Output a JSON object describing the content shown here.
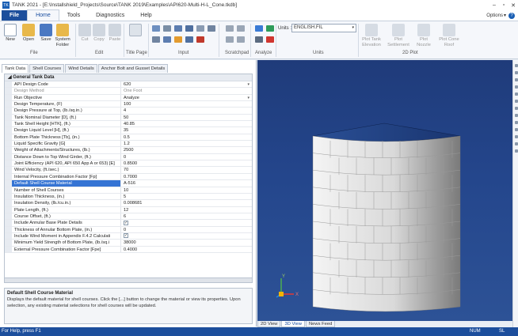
{
  "window": {
    "title": "TANK 2021 - [E:\\Installshield_Projects\\Source\\TANK 2019\\Examples\\API620-Multi-H-L_Cone.tkdb]",
    "app_icon": "TK"
  },
  "menu": {
    "file": "File",
    "tabs": [
      "Home",
      "Tools",
      "Diagnostics",
      "Help"
    ],
    "options": "Options",
    "help_badge": "?"
  },
  "ribbon": {
    "buttons": {
      "new": "New",
      "open": "Open",
      "save": "Save",
      "system_folder": "System\nFolder",
      "cut": "Cut",
      "copy": "Copy",
      "paste": "Paste",
      "plot_tank_elevation": "Plot Tank\nElevation",
      "plot_settlement": "Plot\nSettlement",
      "plot_nozzle": "Plot\nNozzle",
      "plot_cone_roof": "Plot Cone\nRoof"
    },
    "groups": {
      "file": "File",
      "edit": "Edit",
      "title_page": "Title Page",
      "input": "Input",
      "scratchpad": "Scratchpad",
      "analyze": "Analyze",
      "units": "Units",
      "plot_2d": "2D Plot"
    },
    "units_label": "Units :",
    "units_value": "ENGLISH.FIL"
  },
  "subtabs": [
    "Tank Data",
    "Shell Courses",
    "Wind Details",
    "Anchor Bolt and Gusset Details"
  ],
  "grid": {
    "section": "General Tank Data",
    "rows": [
      {
        "label": "API Design Code",
        "value": "620",
        "dropdown": true
      },
      {
        "label": "Design Method",
        "value": "One Foot",
        "dim": true
      },
      {
        "label": "Run Objective",
        "value": "Analyze",
        "dropdown": true
      },
      {
        "label": "Design Temperature, (F)",
        "value": "100"
      },
      {
        "label": "Design Pressure at Top, (lb./sq.in.)",
        "value": "4"
      },
      {
        "label": "Tank Nominal Diameter [D], (ft.)",
        "value": "50"
      },
      {
        "label": "Tank Shell Height [HTK], (ft.)",
        "value": "40.85"
      },
      {
        "label": "Design Liquid Level [H], (ft.)",
        "value": "35"
      },
      {
        "label": "Bottom Plate Thickness [Tb], (in.)",
        "value": "0.5"
      },
      {
        "label": "Liquid Specific Gravity [G]",
        "value": "1.2"
      },
      {
        "label": "Weight of Attachments/Structures, (lb.)",
        "value": "2500"
      },
      {
        "label": "Distance Down to Top Wind Girder, (ft.)",
        "value": "0"
      },
      {
        "label": "Joint Efficiency (API 620, API 650 App A or 653) [E]",
        "value": "0.8500"
      },
      {
        "label": "Wind Velocity, (ft./sec.)",
        "value": "70"
      },
      {
        "label": "Internal Pressure Combination Factor [Fp]",
        "value": "0.7000"
      },
      {
        "label": "Default Shell Course Material",
        "value": "A-516",
        "selected": true
      },
      {
        "label": "Number of Shell Courses",
        "value": "10"
      },
      {
        "label": "Insulation Thickness, (in.)",
        "value": "5"
      },
      {
        "label": "Insulation Density, (lb./cu.in.)",
        "value": "0.008681"
      },
      {
        "label": "Plate Length, (ft.)",
        "value": "12"
      },
      {
        "label": "Course Offset, (ft.)",
        "value": "6"
      },
      {
        "label": "Include Annular Base Plate Details",
        "value": "✓",
        "checkbox": true
      },
      {
        "label": "Thickness of Annular Bottom Plate, (in.)",
        "value": "0"
      },
      {
        "label": "Include Wind Moment in Appendix F.4.2 Calculati",
        "value": "✓",
        "checkbox": true
      },
      {
        "label": "Minimum Yield Strength of Bottom Plate, (lb./sq.i",
        "value": "38000"
      },
      {
        "label": "External Pressure Combination Factor [Fpe]",
        "value": "0.4000"
      }
    ]
  },
  "description": {
    "title": "Default Shell Course Material",
    "text": "Displays the default material for shell courses. Click the [...] button to change the material or view its properties. Upon selection, any existing material selections for shell courses will be updated."
  },
  "view": {
    "tabs": [
      "2D View",
      "3D View",
      "News Feed"
    ],
    "active": "3D View",
    "axis_y": "Y",
    "axis_x": "X"
  },
  "status": {
    "message": "For Help, press F1",
    "num": "NUM",
    "sl": "SL"
  },
  "colors": {
    "accent": "#1c4e9c",
    "view_background": "#24468c",
    "selection": "#3574d4"
  }
}
